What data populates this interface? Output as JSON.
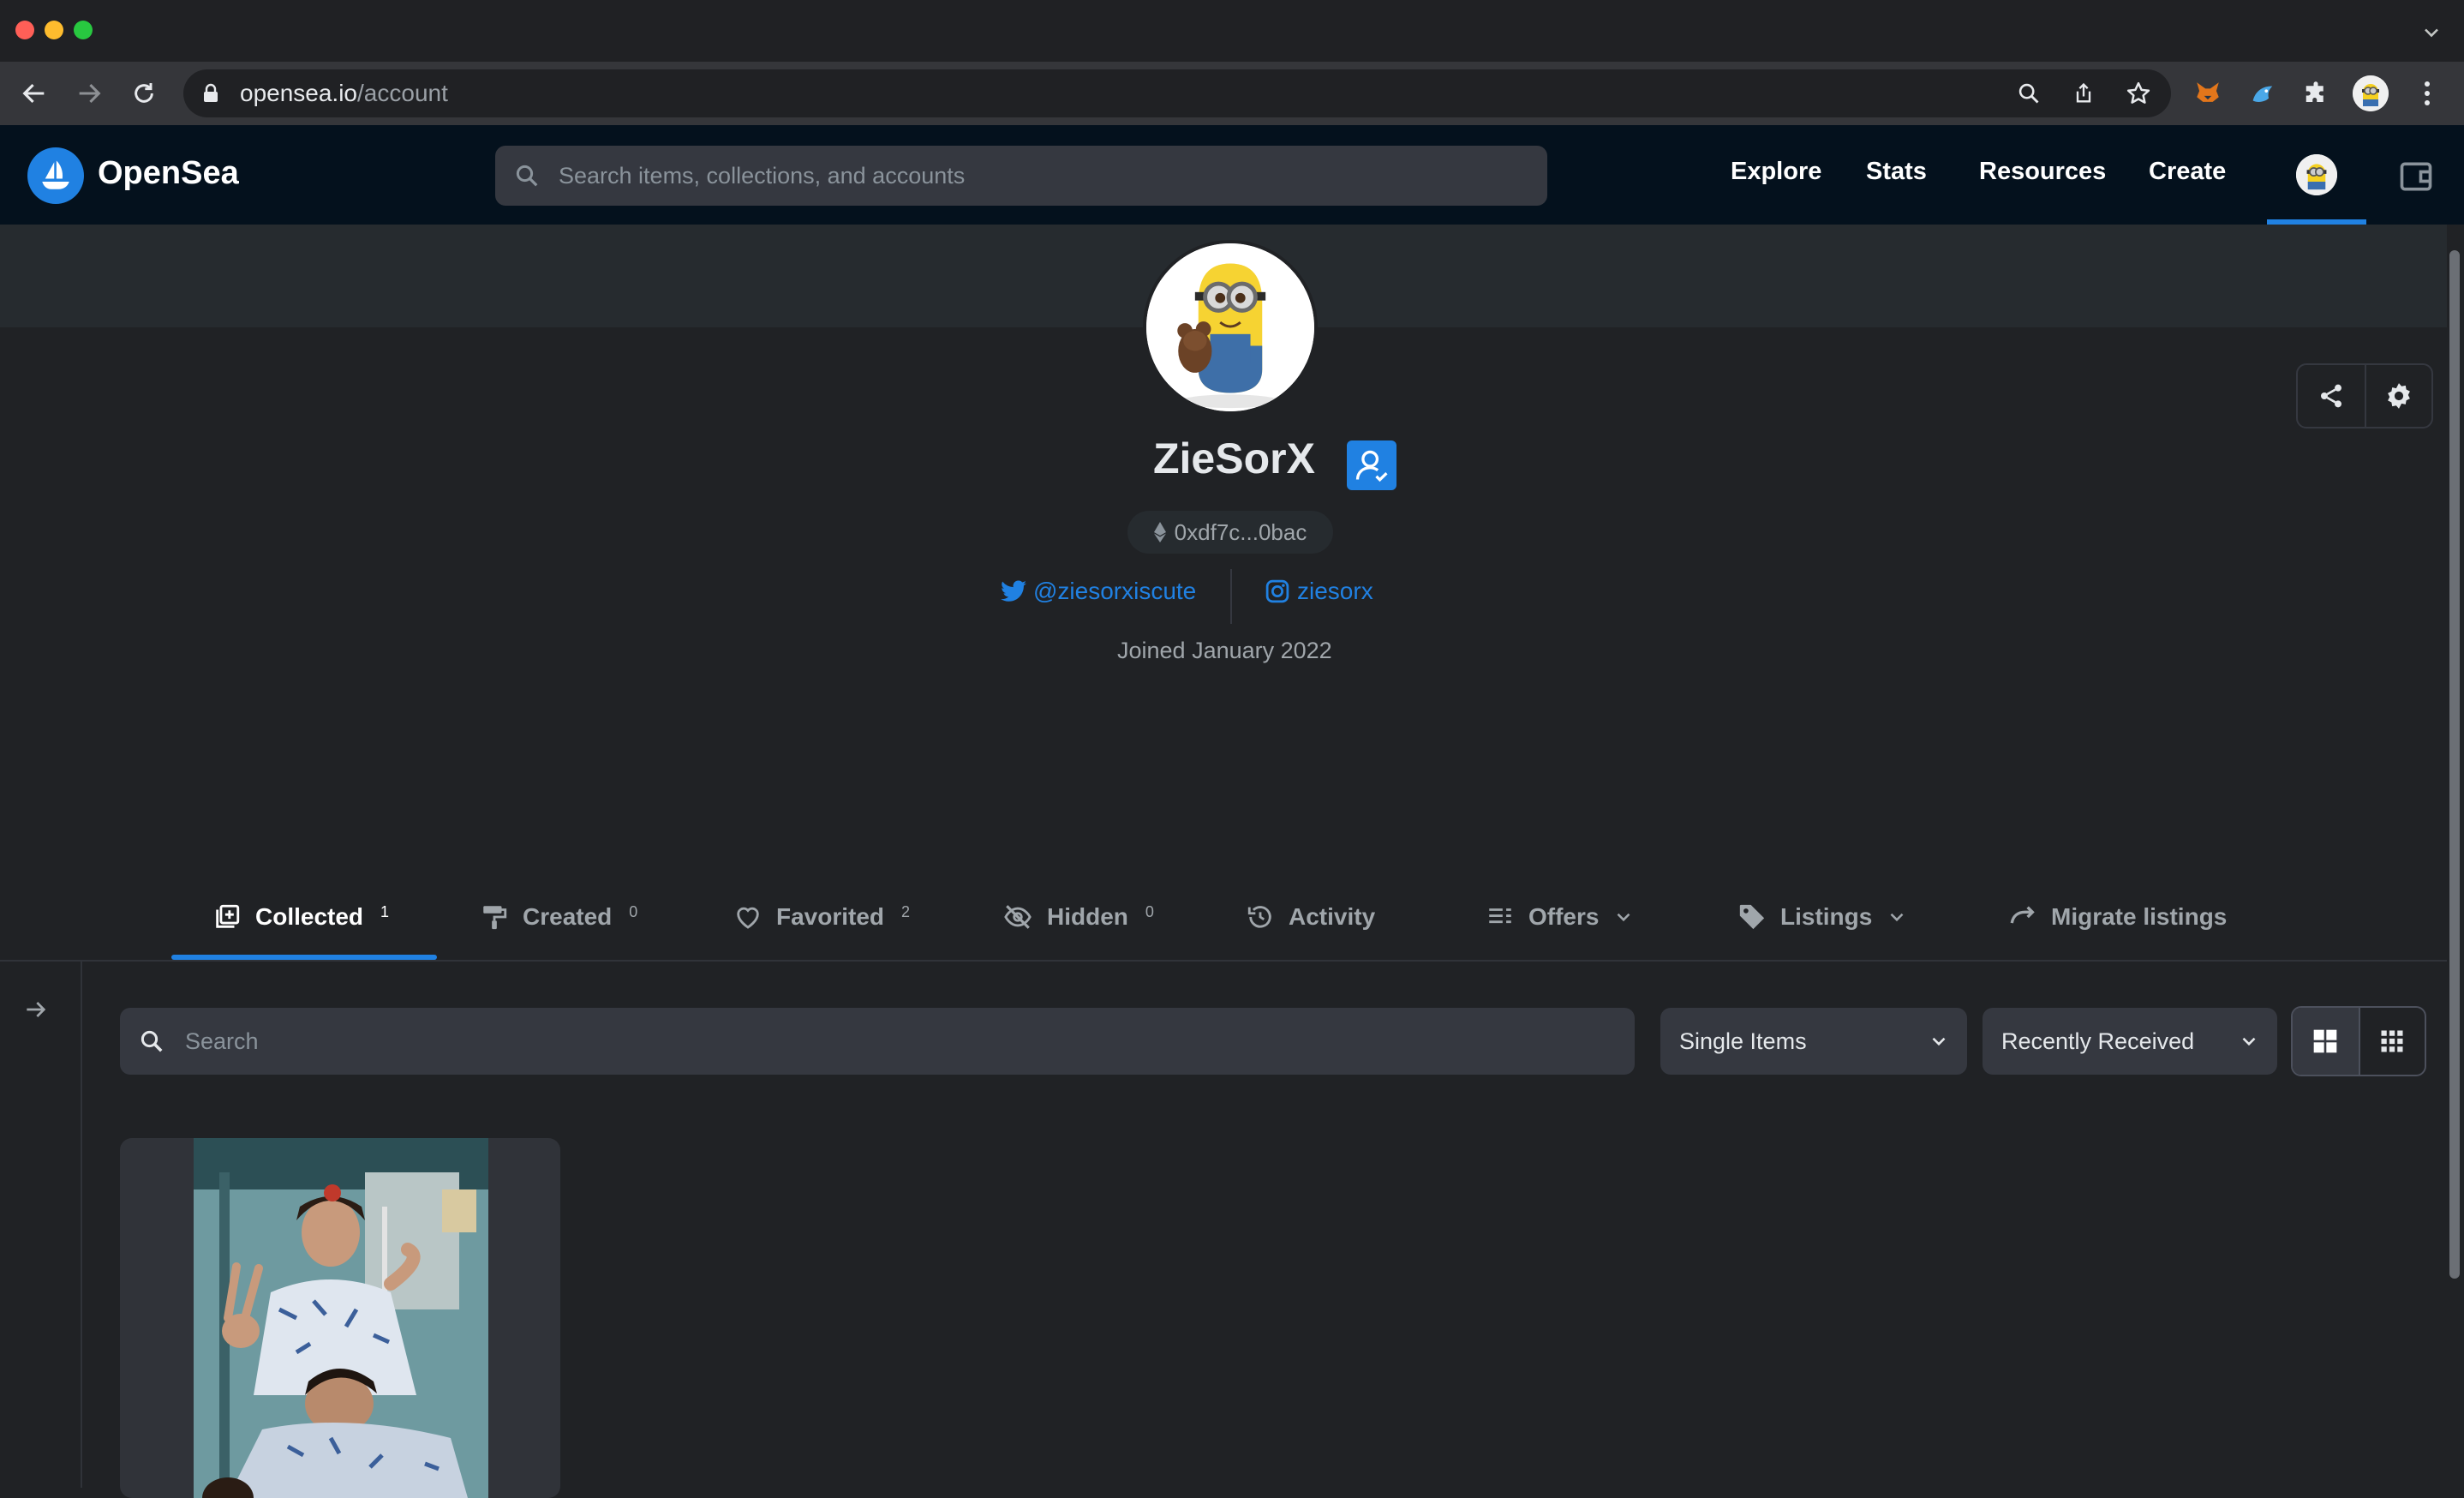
{
  "browser": {
    "url_domain": "opensea.io",
    "url_path": "/account"
  },
  "header": {
    "brand": "OpenSea",
    "search_placeholder": "Search items, collections, and accounts",
    "nav": [
      "Explore",
      "Stats",
      "Resources",
      "Create"
    ]
  },
  "profile": {
    "username": "ZieSorX",
    "address": "0xdf7c...0bac",
    "twitter": "@ziesorxiscute",
    "instagram": "ziesorx",
    "joined": "Joined January 2022"
  },
  "tabs": [
    {
      "label": "Collected",
      "count": "1",
      "active": true
    },
    {
      "label": "Created",
      "count": "0"
    },
    {
      "label": "Favorited",
      "count": "2"
    },
    {
      "label": "Hidden",
      "count": "0"
    },
    {
      "label": "Activity"
    },
    {
      "label": "Offers"
    },
    {
      "label": "Listings"
    },
    {
      "label": "Migrate listings"
    }
  ],
  "filters": {
    "search_placeholder": "Search",
    "item_type": "Single Items",
    "sort": "Recently Received"
  },
  "colors": {
    "accent": "#2081e2",
    "background": "#202225",
    "nav_bg": "#04111d",
    "panel": "#353840"
  }
}
